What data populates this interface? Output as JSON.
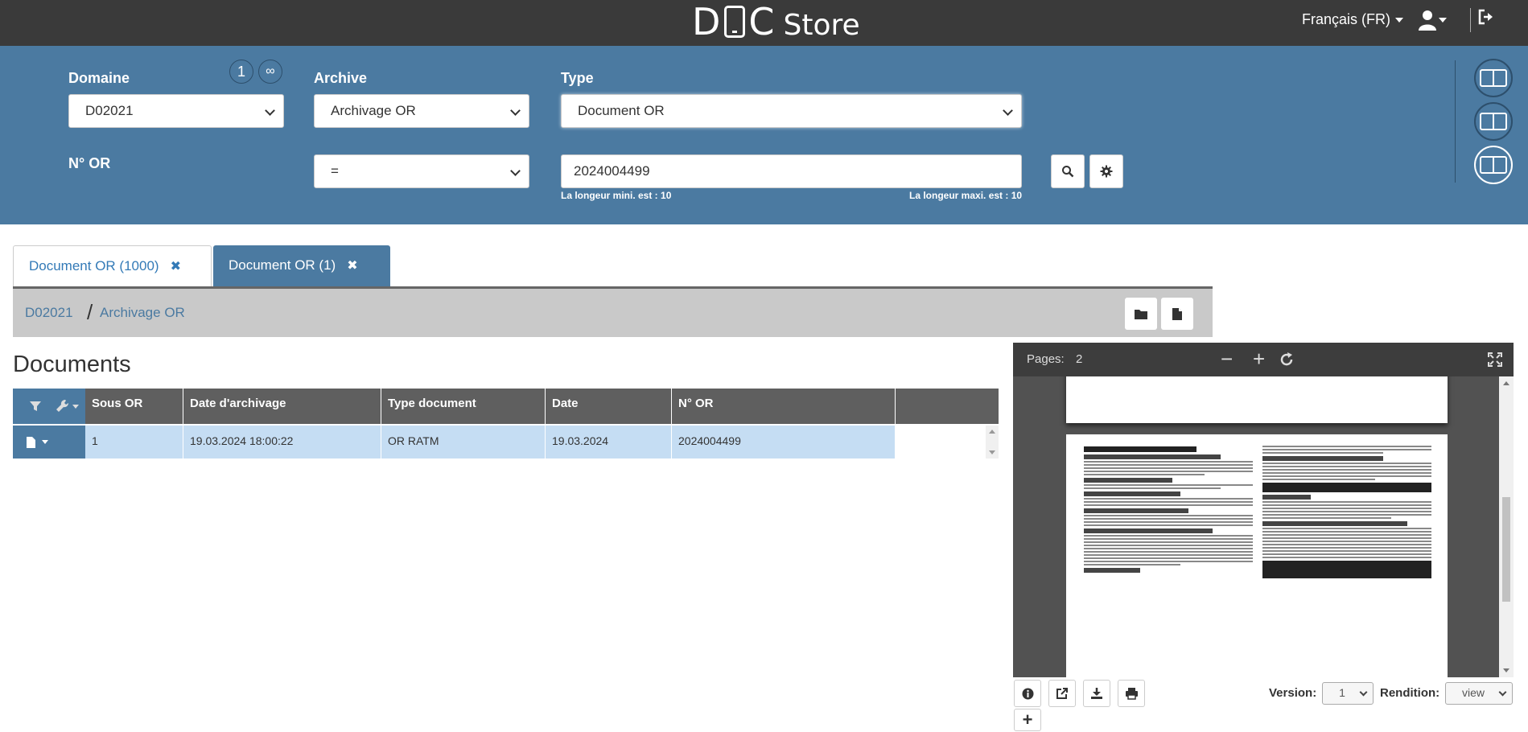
{
  "header": {
    "logo_left": "D",
    "logo_right": "C",
    "logo_store": "Store",
    "language": "Français (FR)"
  },
  "filters": {
    "domaine_label": "Domaine",
    "domaine_value": "D02021",
    "count_one": "1",
    "count_infinite": "∞",
    "archive_label": "Archive",
    "archive_value": "Archivage OR",
    "type_label": "Type",
    "type_value": "Document OR",
    "nor_label": "N° OR",
    "operator_value": "=",
    "nor_value": "2024004499",
    "min_hint": "La longeur mini. est : 10",
    "max_hint": "La longeur maxi. est : 10"
  },
  "tabs": [
    {
      "label": "Document OR (1000)",
      "close": "✖"
    },
    {
      "label": "Document OR (1)",
      "close": "✖"
    }
  ],
  "breadcrumb": {
    "item1": "D02021",
    "separator": "/",
    "item2": "Archivage OR"
  },
  "documents": {
    "title": "Documents",
    "columns": [
      "Sous OR",
      "Date d'archivage",
      "Type document",
      "Date",
      "N° OR"
    ],
    "rows": [
      [
        "1",
        "19.03.2024 18:00:22",
        "OR RATM",
        "19.03.2024",
        "2024004499"
      ]
    ]
  },
  "viewer": {
    "pages_label": "Pages:",
    "pages_value": "2",
    "minus": "−",
    "plus": "+",
    "version_label": "Version:",
    "version_value": "1",
    "rendition_label": "Rendition:",
    "rendition_value": "view",
    "add": "+"
  },
  "colors": {
    "topbar": "#3a3a3a",
    "panel": "#4b7aa1",
    "row_selected": "#c5ddf3",
    "table_header": "#5f5f5f"
  }
}
